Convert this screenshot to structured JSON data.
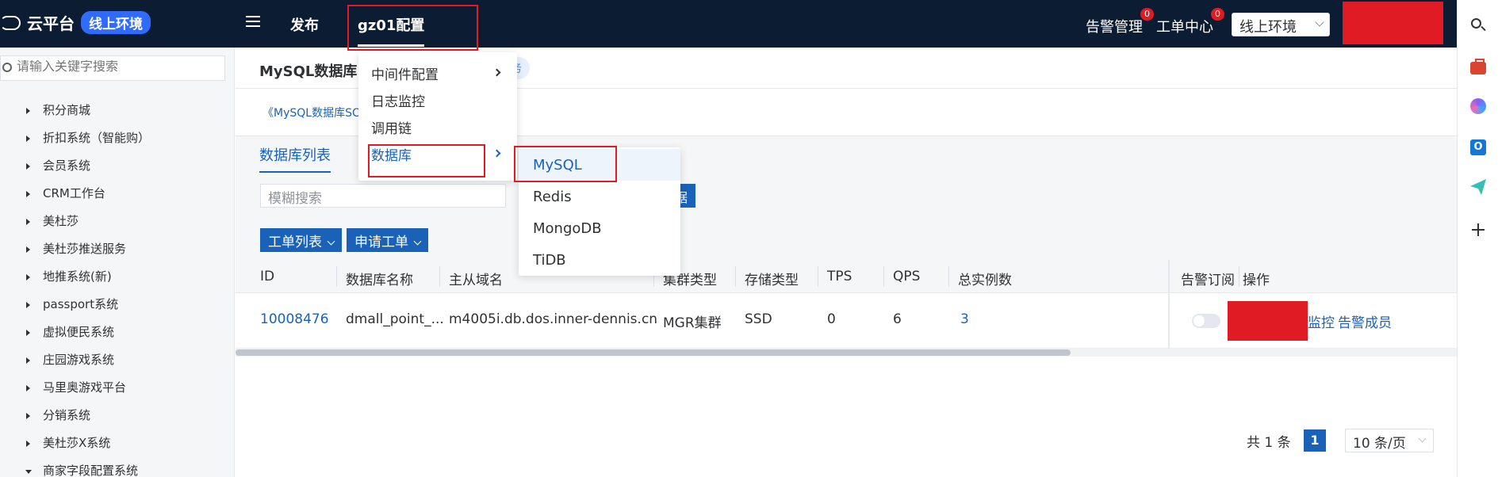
{
  "header": {
    "brand": "云平台",
    "env_badge": "线上环境",
    "nav": {
      "publish": "发布",
      "config": "gz01配置"
    },
    "alert_mgmt": "告警管理",
    "alert_mgmt_badge": "0",
    "ticket_center": "工单中心",
    "ticket_center_badge": "0",
    "env_select": "线上环境"
  },
  "sidebar": {
    "search_placeholder": "请输入关键字搜索",
    "items": [
      {
        "label": "积分商城",
        "expanded": false
      },
      {
        "label": "折扣系统（智能购）",
        "expanded": false
      },
      {
        "label": "会员系统",
        "expanded": false
      },
      {
        "label": "CRM工作台",
        "expanded": false
      },
      {
        "label": "美杜莎",
        "expanded": false
      },
      {
        "label": "美杜莎推送服务",
        "expanded": false
      },
      {
        "label": "地推系统(新)",
        "expanded": false
      },
      {
        "label": "passport系统",
        "expanded": false
      },
      {
        "label": "虚拟便民系统",
        "expanded": false
      },
      {
        "label": "庄园游戏系统",
        "expanded": false
      },
      {
        "label": "马里奥游戏平台",
        "expanded": false
      },
      {
        "label": "分销系统",
        "expanded": false
      },
      {
        "label": "美杜莎X系统",
        "expanded": false
      },
      {
        "label": "商家字段配置系统",
        "expanded": true
      }
    ]
  },
  "main": {
    "title": "MySQL数据库",
    "tag_partial": "务",
    "doc_link": "《MySQL数据库SC",
    "tab_active": "数据库列表",
    "fuzzy_placeholder": "模糊搜索",
    "sync_button_partial": "据",
    "ticket_list_btn": "工单列表",
    "apply_ticket_btn": "申请工单"
  },
  "table": {
    "headers": [
      "ID",
      "数据库名称",
      "主从域名",
      "集群类型",
      "存储类型",
      "TPS",
      "QPS",
      "总实例数",
      "告警订阅",
      "操作"
    ],
    "rows": [
      {
        "id": "10008476",
        "db_name": "dmall_point_...",
        "master_slave_domain": "m4005i.db.dos.inner-dennis.cn",
        "cluster_type": "MGR集群",
        "storage_type": "SSD",
        "tps": "0",
        "qps": "6",
        "instances": "3",
        "alert_subscribed": false,
        "actions": [
          "监控",
          "告警成员"
        ]
      }
    ]
  },
  "pagination": {
    "total": "共 1 条",
    "current_page": "1",
    "page_size": "10 条/页"
  },
  "config_menu": {
    "items": [
      {
        "label": "中间件配置",
        "has_submenu": true
      },
      {
        "label": "日志监控",
        "has_submenu": false
      },
      {
        "label": "调用链",
        "has_submenu": false
      },
      {
        "label": "数据库",
        "has_submenu": true
      }
    ],
    "db_submenu": [
      "MySQL",
      "Redis",
      "MongoDB",
      "TiDB"
    ]
  },
  "colors": {
    "header_bg": "#0c1c33",
    "accent": "#1a62b8",
    "highlight_red": "#e01b24",
    "badge_blue": "#2f6bff"
  },
  "rail_icons": [
    "search-icon",
    "briefcase-icon",
    "copilot-icon",
    "outlook-icon",
    "send-icon",
    "plus-icon"
  ]
}
